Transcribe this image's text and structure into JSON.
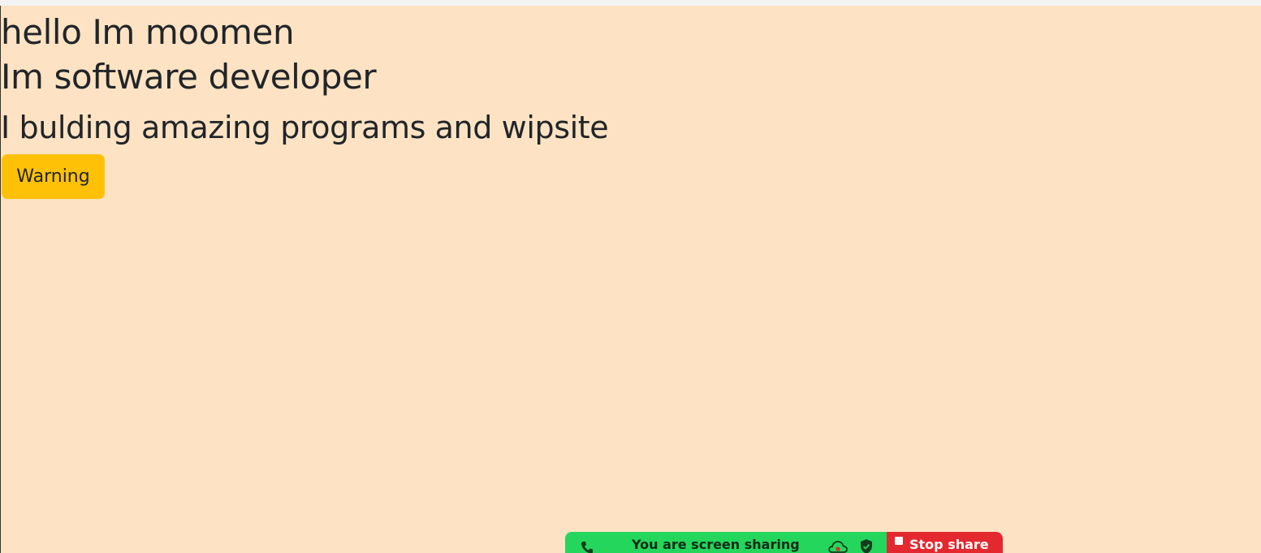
{
  "content": {
    "heading_line1": "hello Im moomen",
    "heading_line2": "Im software developer",
    "subheading": "I bulding amazing programs and wipsite",
    "warning_button": "Warning"
  },
  "share_bar": {
    "status_text": "You are screen sharing",
    "stop_label": "Stop share",
    "phone_icon": "phone-icon",
    "cloud_icon": "cloud-icon",
    "shield_icon": "shield-icon"
  },
  "colors": {
    "page_background": "#fde3c3",
    "warning": "#ffc107",
    "share_green": "#25d65c",
    "stop_red": "#e3282f"
  }
}
